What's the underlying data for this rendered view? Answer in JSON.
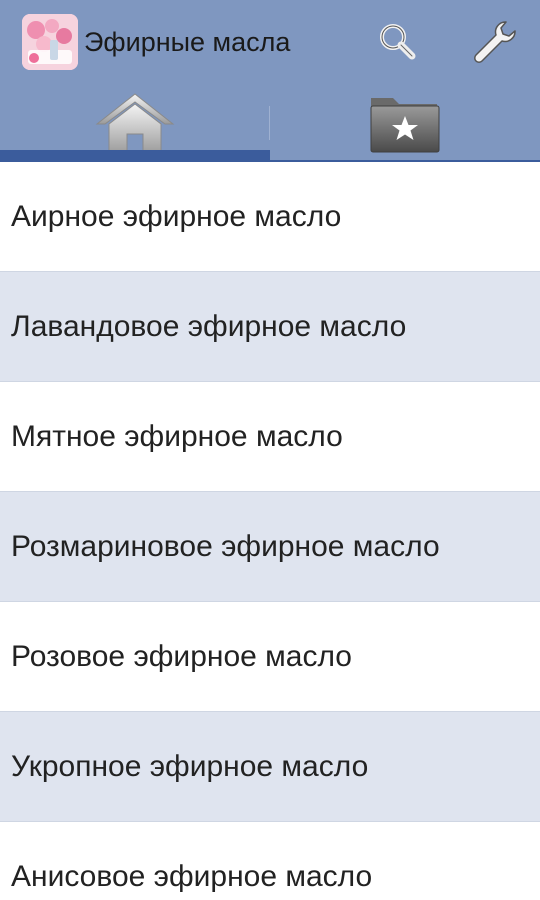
{
  "colors": {
    "actionbar": "#7f97c0",
    "tab_indicator": "#3b5c9c",
    "row_alt": "#dfe4ef",
    "row": "#ffffff"
  },
  "actionbar": {
    "title": "Эфирные масла",
    "icons": [
      "app-logo-icon",
      "search-icon",
      "wrench-settings-icon"
    ]
  },
  "tabs": [
    {
      "icon": "home-icon",
      "selected": true
    },
    {
      "icon": "favorites-folder-star-icon",
      "selected": false
    }
  ],
  "list": {
    "items": [
      {
        "label": "Аирное эфирное масло"
      },
      {
        "label": "Лавандовое эфирное масло"
      },
      {
        "label": "Мятное эфирное масло"
      },
      {
        "label": "Розмариновое эфирное масло"
      },
      {
        "label": "Розовое эфирное масло"
      },
      {
        "label": "Укропное эфирное масло"
      },
      {
        "label": "Анисовое эфирное масло"
      }
    ]
  }
}
